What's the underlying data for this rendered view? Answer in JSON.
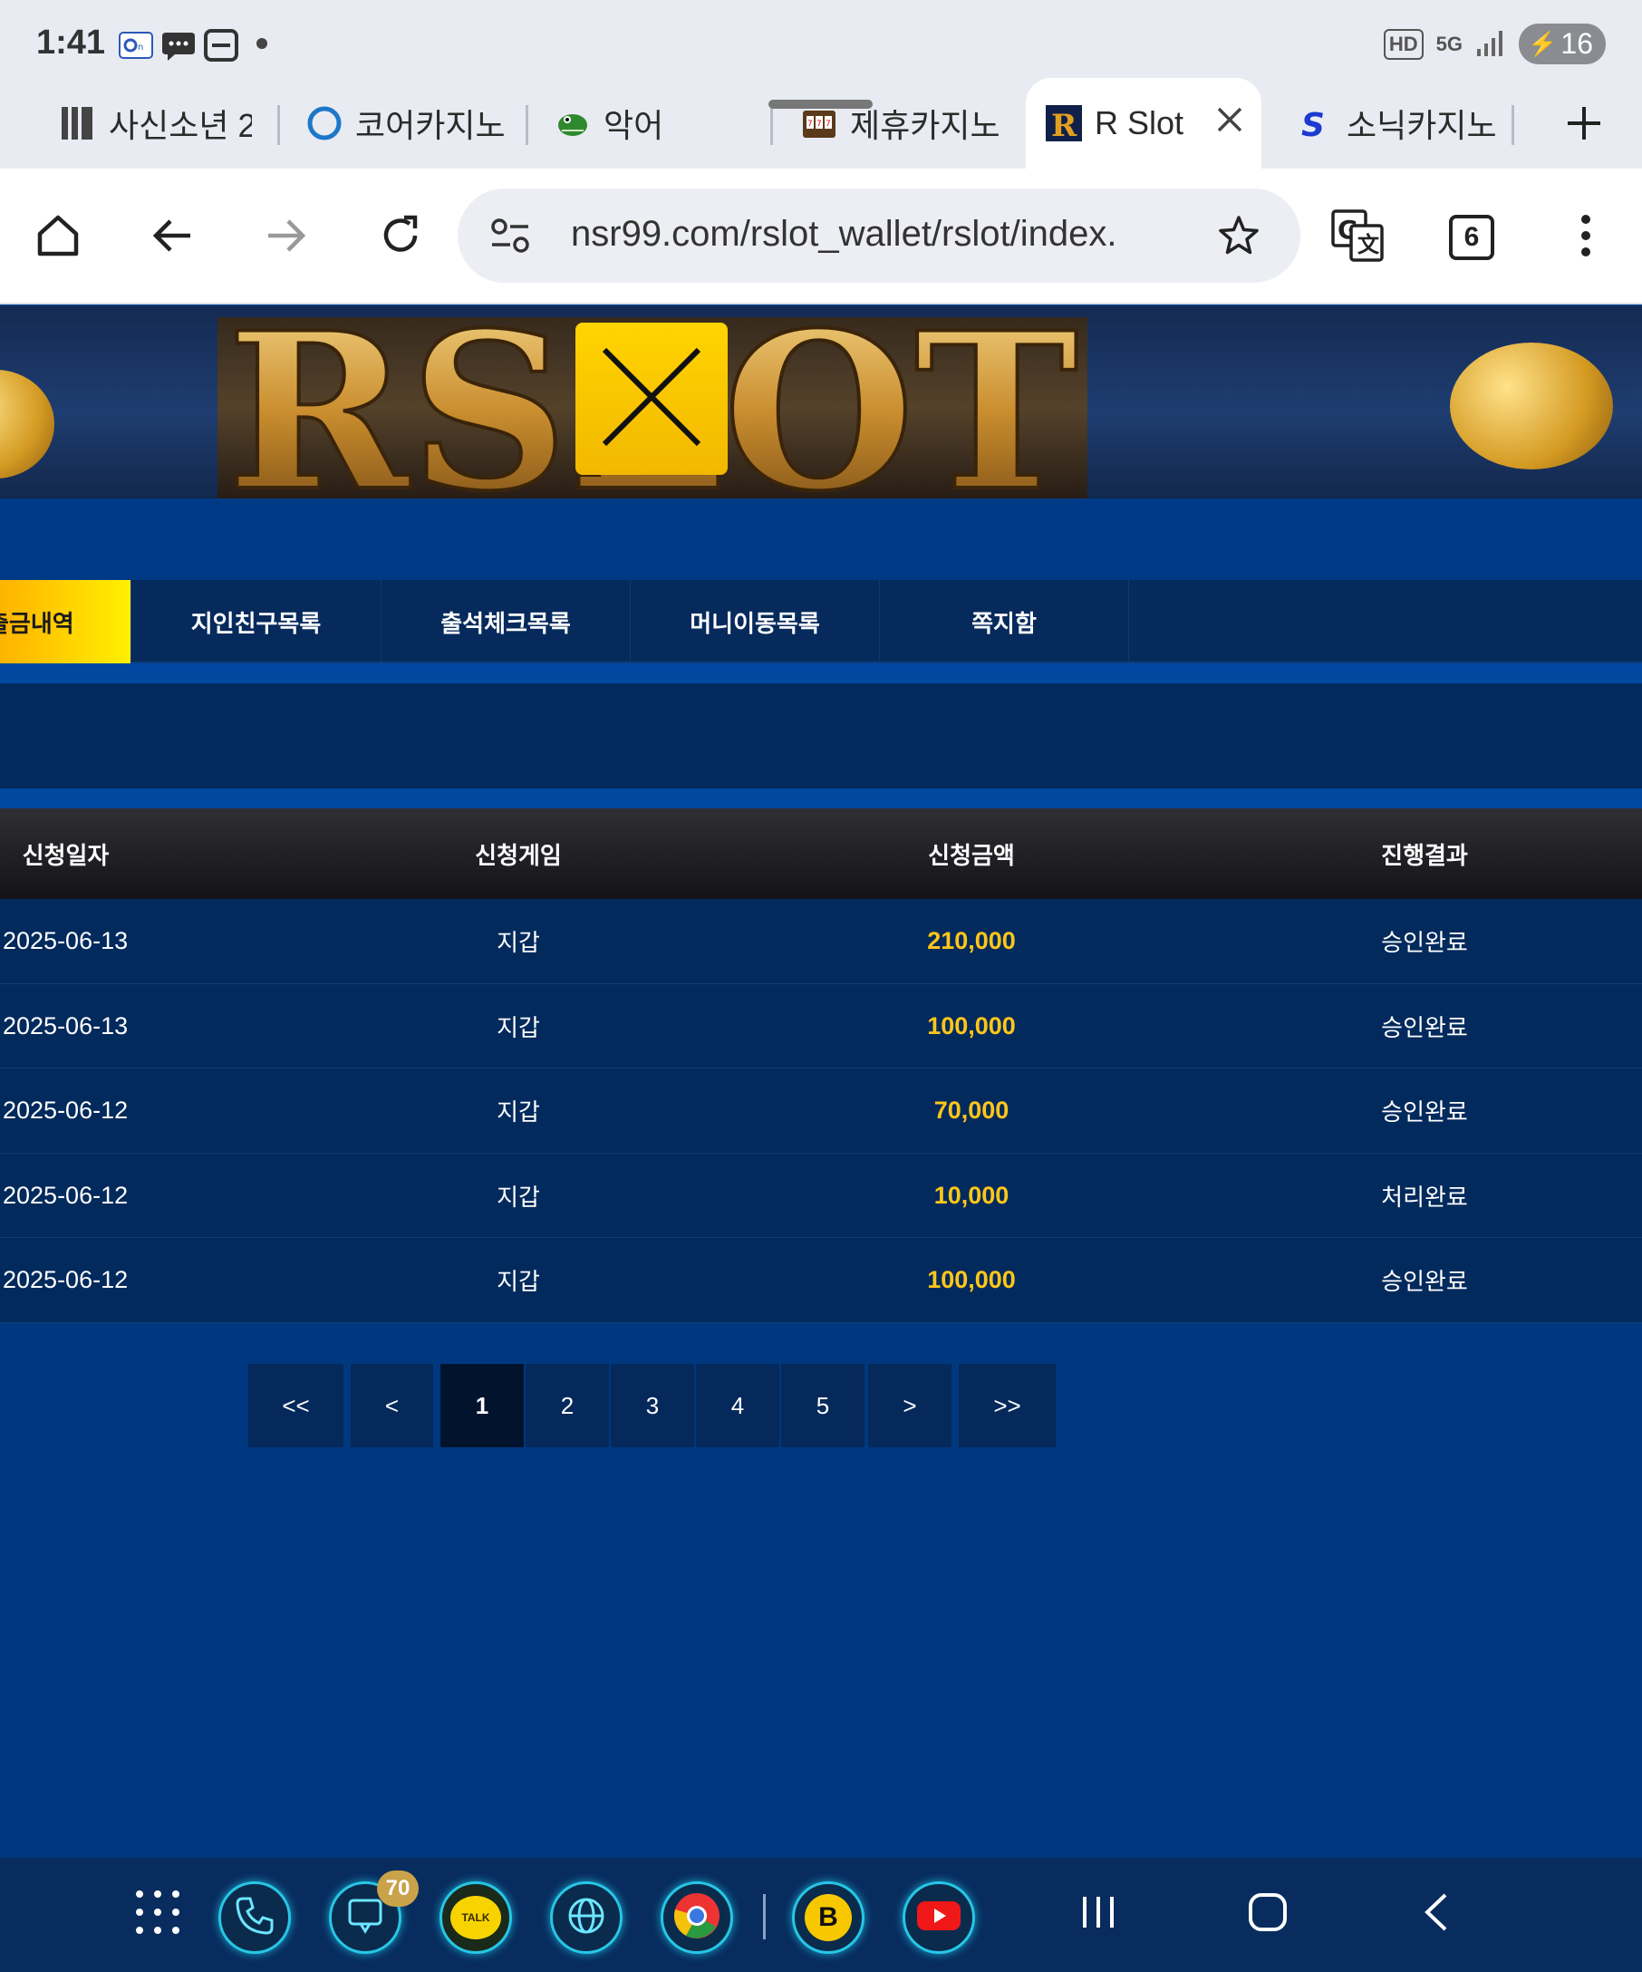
{
  "status_bar": {
    "time": "1:41",
    "indicators": [
      "HD",
      "5G"
    ],
    "battery": "16"
  },
  "tabs": [
    {
      "label": "사신소년 2",
      "icon": "barcode-icon"
    },
    {
      "label": "코어카지노",
      "icon": "ring-icon"
    },
    {
      "label": "악어",
      "icon": "crocodile-icon"
    },
    {
      "label": "제휴카지노",
      "icon": "slot-machine-icon"
    },
    {
      "label": "R Slot",
      "icon": "r-logo-icon",
      "active": true
    },
    {
      "label": "소닉카지노",
      "icon": "s-logo-icon"
    }
  ],
  "toolbar": {
    "url": "nsr99.com/rslot_wallet/rslot/index.",
    "tab_count": "6"
  },
  "banner": {
    "logo_text": "RSLOT"
  },
  "nav_menu": [
    {
      "label": "출금내역",
      "active": true
    },
    {
      "label": "지인친구목록"
    },
    {
      "label": "출석체크목록"
    },
    {
      "label": "머니이동목록"
    },
    {
      "label": "쪽지함"
    }
  ],
  "table": {
    "headers": [
      "신청일자",
      "신청게임",
      "신청금액",
      "진행결과"
    ],
    "rows": [
      {
        "date": "2025-06-13",
        "game": "지갑",
        "amount": "210,000",
        "result": "승인완료"
      },
      {
        "date": "2025-06-13",
        "game": "지갑",
        "amount": "100,000",
        "result": "승인완료"
      },
      {
        "date": "2025-06-12",
        "game": "지갑",
        "amount": "70,000",
        "result": "승인완료"
      },
      {
        "date": "2025-06-12",
        "game": "지갑",
        "amount": "10,000",
        "result": "처리완료"
      },
      {
        "date": "2025-06-12",
        "game": "지갑",
        "amount": "100,000",
        "result": "승인완료"
      }
    ]
  },
  "pagination": {
    "first": "<<",
    "prev": "<",
    "pages": [
      "1",
      "2",
      "3",
      "4",
      "5"
    ],
    "current": "1",
    "next": ">",
    "last": ">>"
  },
  "dock": {
    "apps": [
      "phone-icon",
      "messages-icon",
      "kakaotalk-icon",
      "internet-icon",
      "chrome-icon",
      "b-app-icon",
      "youtube-icon"
    ],
    "kakao_label": "TALK",
    "b_label": "B",
    "messages_badge": "70"
  },
  "colors": {
    "page_bg": "#003880",
    "accent_yellow": "#ffd400",
    "amount_text": "#ffc61a"
  }
}
